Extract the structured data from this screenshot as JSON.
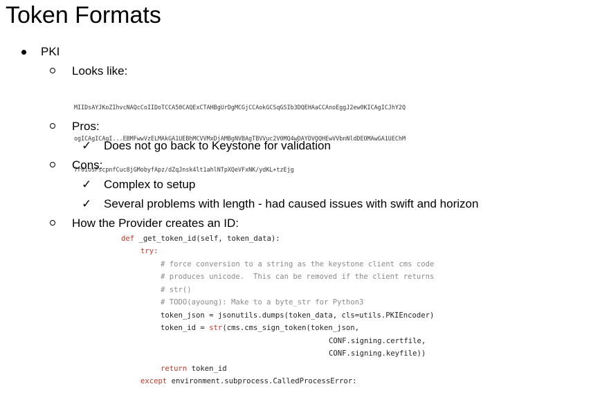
{
  "title": "Token Formats",
  "bullet": "PKI",
  "sections": {
    "looks_like": {
      "label": "Looks like:",
      "token_lines": [
        "MIIDsAYJKoZIhvcNAQcCoIIDoTCCA50CAQExCTAHBgUrDgMCGjCCAokGCSqGSIb3DQEHAaCCAnoEggJ2ew0KICAgICJhY2Q",
        "ogICAgICAgI...EBMFwwVzELMAkGA1UEBhMCVVMxDjAMBgNVBAgTBVVuc2V0MQ4wDAYDVQQHEwVVbnNldDEOMAwGA1UEChM",
        "7r0iosFscpnfCuc8jGMobyfApz/dZqJnsk4lt1ahlNTpXQeVFxNK/ydKL+tzEjg"
      ]
    },
    "pros": {
      "label": "Pros:",
      "check": "✓",
      "items": [
        "Does not go back to Keystone for validation"
      ]
    },
    "cons": {
      "label": "Cons:",
      "check": "✓",
      "items": [
        "Complex to setup",
        "Several problems with length - had caused issues with swift and horizon"
      ]
    },
    "provider": {
      "label": "How the Provider creates an ID:"
    }
  },
  "code": {
    "l1": {
      "kw": "def",
      "rest": " _get_token_id(self, token_data):"
    },
    "l2": {
      "kw": "try:"
    },
    "l3": "# force conversion to a string as the keystone client cms code",
    "l4": "# produces unicode.  This can be removed if the client returns",
    "l5": "# str()",
    "l6": "# TODO(ayoung): Make to a byte_str for Python3",
    "l7": "token_json = jsonutils.dumps(token_data, cls=utils.PKIEncoder)",
    "l8": {
      "pre": "token_id = ",
      "kw": "str",
      "rest": "(cms.cms_sign_token(token_json,"
    },
    "l9": "CONF.signing.certfile,",
    "l10": "CONF.signing.keyfile))",
    "l11": {
      "kw": "return",
      "rest": " token_id"
    },
    "l12": {
      "kw": "except",
      "rest": " environment.subprocess.CalledProcessError:"
    }
  },
  "colors": {
    "keyword": "#c0392b",
    "comment": "#8a8a8a",
    "code_text": "#222222"
  }
}
